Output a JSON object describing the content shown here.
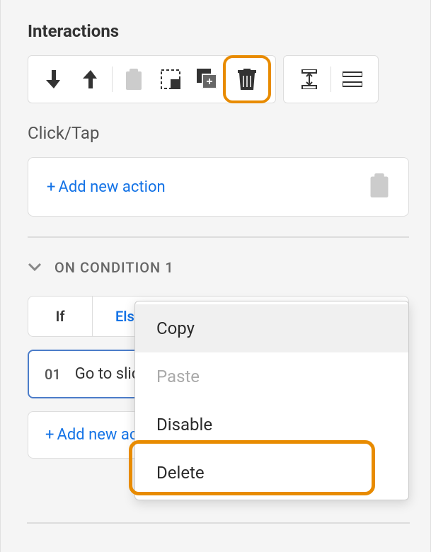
{
  "title": "Interactions",
  "toolbar": {
    "icons": [
      {
        "name": "move-down-icon"
      },
      {
        "name": "move-up-icon"
      },
      {
        "name": "clipboard-icon"
      },
      {
        "name": "marquee-icon"
      },
      {
        "name": "duplicate-icon"
      },
      {
        "name": "trash-icon"
      }
    ],
    "group2": [
      {
        "name": "distribute-vertical-icon"
      },
      {
        "name": "distribute-horizontal-icon"
      }
    ]
  },
  "trigger_label": "Click/Tap",
  "add_action_label": "Add new action",
  "condition": {
    "label": "ON CONDITION 1",
    "tab_if": "If",
    "tab_else": "Else",
    "action_num": "01",
    "action_text": "Go to slide",
    "add_action_partial": "Add new act"
  },
  "context_menu": {
    "items": [
      {
        "label": "Copy",
        "state": "hover"
      },
      {
        "label": "Paste",
        "state": "disabled"
      },
      {
        "label": "Disable",
        "state": "normal"
      },
      {
        "label": "Delete",
        "state": "normal"
      }
    ]
  }
}
